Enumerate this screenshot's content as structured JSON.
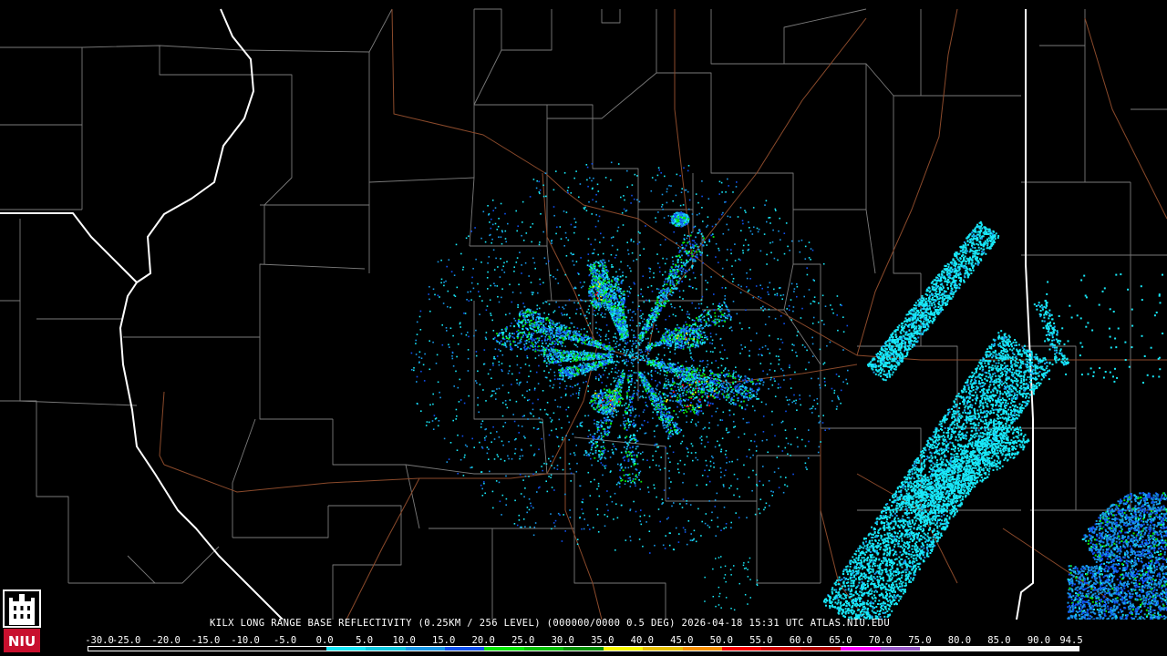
{
  "product": {
    "title": "KILX LONG RANGE BASE REFLECTIVITY (0.25KM / 256 LEVEL) (000000/0000 0.5 DEG) 2026-04-18 15:31 UTC  ATLAS.NIU.EDU"
  },
  "legend": {
    "labels": [
      "-30.0",
      "-25.0",
      "-20.0",
      "-15.0",
      "-10.0",
      "-5.0",
      "0.0",
      "5.0",
      "10.0",
      "15.0",
      "20.0",
      "25.0",
      "30.0",
      "35.0",
      "40.0",
      "45.0",
      "50.0",
      "55.0",
      "60.0",
      "65.0",
      "70.0",
      "75.0",
      "80.0",
      "85.0",
      "90.0",
      "94.5"
    ],
    "colors": [
      "#000000",
      "#000000",
      "#000000",
      "#000000",
      "#000000",
      "#000000",
      "#18e8f8",
      "#10c8e0",
      "#1898e8",
      "#1050f0",
      "#08e808",
      "#06c006",
      "#049004",
      "#f8f800",
      "#e8c000",
      "#f89000",
      "#f80000",
      "#d00000",
      "#b00000",
      "#f800f8",
      "#9858c8",
      "#f8f8f8",
      "#f8f8f8",
      "#f8f8f8",
      "#f8f8f8"
    ]
  },
  "logo": {
    "text": "NIU",
    "icon": "niu-castle-logo-icon",
    "color": "#c8102e"
  },
  "map": {
    "colors": {
      "background": "#000000",
      "county_border": "#7a7a7a",
      "state_border": "#ffffff",
      "highway": "#8b4a2b",
      "radar_light": "#18e8f8",
      "radar_mid": "#1898e8",
      "radar_dark": "#1050f0",
      "radar_green": "#08e808",
      "radar_yellow": "#f8f800",
      "radar_red": "#f80000"
    }
  }
}
